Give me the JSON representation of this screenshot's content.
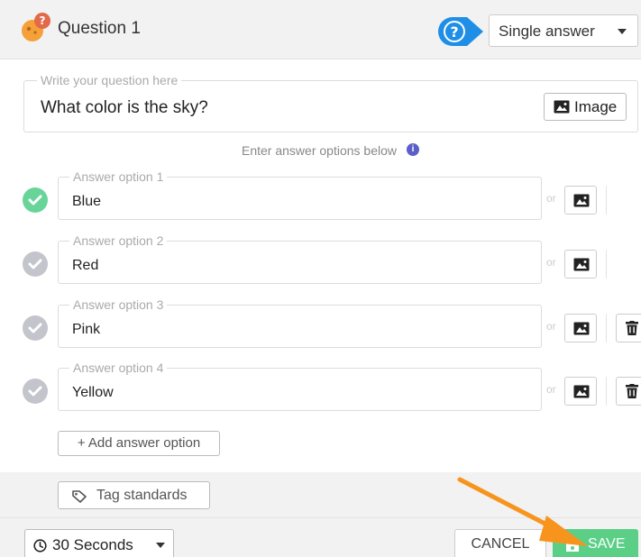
{
  "header": {
    "title": "Question 1",
    "answer_type": "Single answer",
    "help_icon": "question-icon"
  },
  "question": {
    "legend": "Write your question here",
    "text": "What color is the sky?",
    "image_button_label": "Image"
  },
  "hint": "Enter answer options below",
  "answers": [
    {
      "legend": "Answer option 1",
      "value": "Blue",
      "correct": true
    },
    {
      "legend": "Answer option 2",
      "value": "Red",
      "correct": false
    },
    {
      "legend": "Answer option 3",
      "value": "Pink",
      "correct": false
    },
    {
      "legend": "Answer option 4",
      "value": "Yellow",
      "correct": false
    }
  ],
  "or_label": "or",
  "add_option_label": "+ Add answer option",
  "tag_standards_label": "Tag standards",
  "footer": {
    "timer": "30 Seconds",
    "cancel_label": "CANCEL",
    "save_label": "SAVE"
  },
  "colors": {
    "correct_check": "#69d49a",
    "inactive_check": "#c3c4cc",
    "save_button": "#5ccf87",
    "help_badge": "#1f8ee6",
    "arrow": "#f7941d"
  }
}
